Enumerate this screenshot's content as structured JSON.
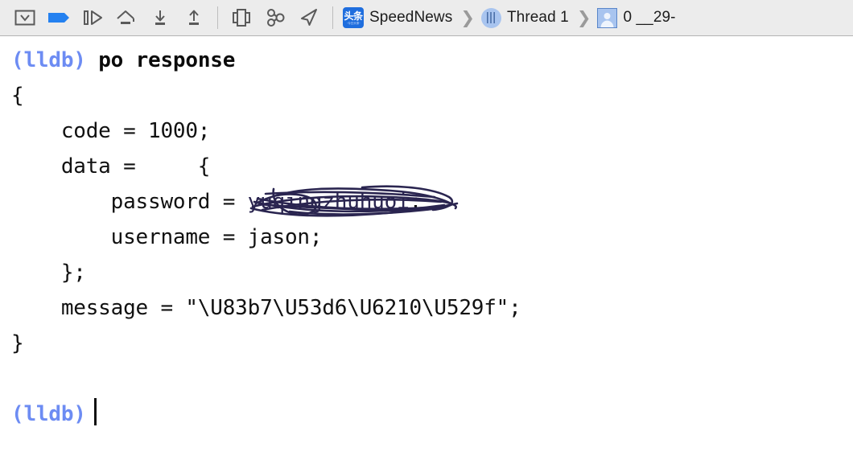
{
  "toolbar": {
    "buttons": [
      {
        "name": "hide-debug-area-button",
        "title": "Hide Debug Area"
      },
      {
        "name": "breakpoints-toggle-button",
        "title": "Deactivate Breakpoints"
      },
      {
        "name": "continue-button",
        "title": "Continue program execution"
      },
      {
        "name": "step-over-button",
        "title": "Step over"
      },
      {
        "name": "step-into-button",
        "title": "Step into"
      },
      {
        "name": "step-out-button",
        "title": "Step out"
      },
      {
        "name": "debug-view-hierarchy-button",
        "title": "Debug View Hierarchy"
      },
      {
        "name": "debug-memory-graph-button",
        "title": "Debug Memory Graph"
      },
      {
        "name": "simulate-location-button",
        "title": "Simulate Location"
      }
    ],
    "breadcrumb": [
      {
        "icon": "app-icon",
        "label": "SpeedNews"
      },
      {
        "icon": "thread-icon",
        "label": "Thread 1"
      },
      {
        "icon": "frame-icon",
        "label": "0 __29-"
      }
    ],
    "breadcrumb_separator": "❯",
    "app_icon_text": "头条",
    "app_icon_subtext": "·今日头条·"
  },
  "console": {
    "prompt": "(lldb)",
    "command": "po response",
    "lines": [
      "{",
      "    code = 1000;",
      "    data =     {",
      "        password = ",
      "        username = jason;",
      "    };",
      "    message = \"\\U83b7\\U53d6\\U6210\\U529f\";",
      "}"
    ],
    "password_value": "yuqingzhuhuoi",
    "password_terminator": ";",
    "final_prompt": "(lldb)"
  },
  "colors": {
    "prompt_blue": "#6d8cf3",
    "breakpoint_blue": "#2481f0",
    "toolbar_bg": "#ececec",
    "console_bg": "#ffffff",
    "scribble_ink": "#2a2550",
    "text": "#111111"
  }
}
